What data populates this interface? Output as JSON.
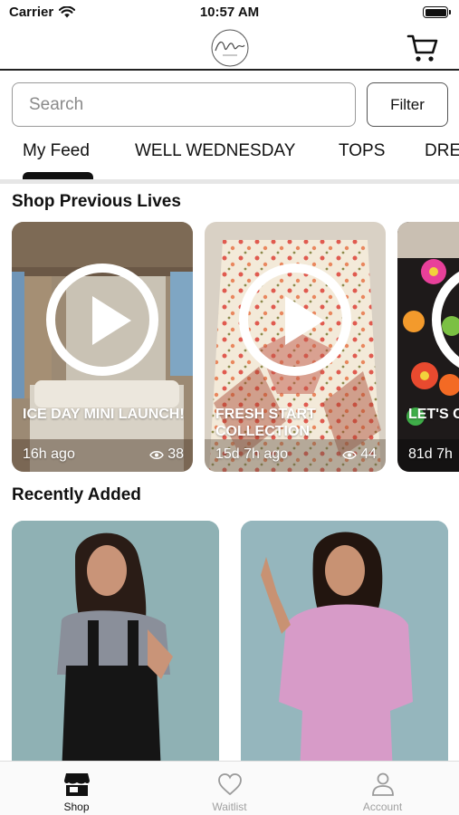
{
  "status_bar": {
    "carrier": "Carrier",
    "time": "10:57 AM"
  },
  "header": {
    "logo_icon": "script-logo",
    "cart_icon": "cart-icon"
  },
  "search": {
    "placeholder": "Search",
    "filter_label": "Filter"
  },
  "tabs": [
    {
      "label": "My Feed",
      "active": true
    },
    {
      "label": "WELL WEDNESDAY"
    },
    {
      "label": "TOPS"
    },
    {
      "label": "DRE"
    }
  ],
  "sections": {
    "previous_lives": "Shop Previous Lives",
    "recently_added": "Recently Added"
  },
  "lives": [
    {
      "title": "ICE DAY  MINI LAUNCH!",
      "time": "16h ago",
      "views": "38"
    },
    {
      "title": "FRESH START COLLECTION",
      "time": "15d 7h ago",
      "views": "44"
    },
    {
      "title": "LET'S C SWEAT",
      "time": "81d 7h",
      "views": ""
    }
  ],
  "products": [
    {
      "image_icon": "model-overalls-photo",
      "bg": "#8fb1b4"
    },
    {
      "image_icon": "model-pink-top-photo",
      "bg": "#95b6bd"
    }
  ],
  "bottom_nav": [
    {
      "label": "Shop",
      "icon": "store-icon",
      "active": true
    },
    {
      "label": "Waitlist",
      "icon": "heart-icon"
    },
    {
      "label": "Account",
      "icon": "person-icon"
    }
  ],
  "colors": {
    "accent": "#111111",
    "inactive": "#a0a0a0",
    "divider": "#e6e6e6"
  }
}
